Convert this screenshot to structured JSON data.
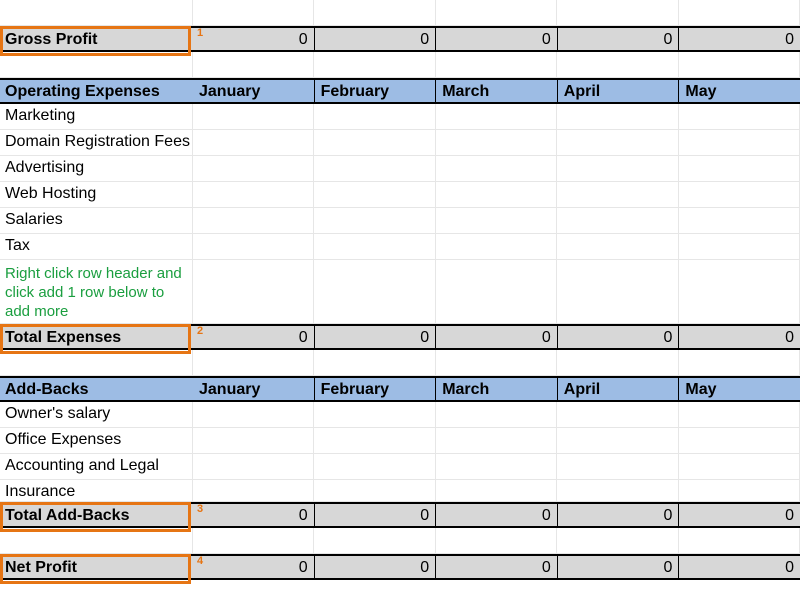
{
  "months": [
    "January",
    "February",
    "March",
    "April",
    "May"
  ],
  "zeros": [
    "0",
    "0",
    "0",
    "0",
    "0"
  ],
  "gross_profit": {
    "label": "Gross Profit",
    "marker": "1"
  },
  "op_expenses": {
    "heading": "Operating Expenses",
    "items": [
      "Marketing",
      "Domain Registration Fees",
      "Advertising",
      "Web Hosting",
      "Salaries",
      "Tax"
    ]
  },
  "hint": "Right click row header and click add 1 row below to add more",
  "total_expenses": {
    "label": "Total Expenses",
    "marker": "2"
  },
  "addbacks": {
    "heading": "Add-Backs",
    "items": [
      "Owner's salary",
      "Office Expenses",
      "Accounting and Legal",
      "Insurance"
    ]
  },
  "total_addbacks": {
    "label": "Total Add-Backs",
    "marker": "3"
  },
  "net_profit": {
    "label": "Net Profit",
    "marker": "4"
  }
}
